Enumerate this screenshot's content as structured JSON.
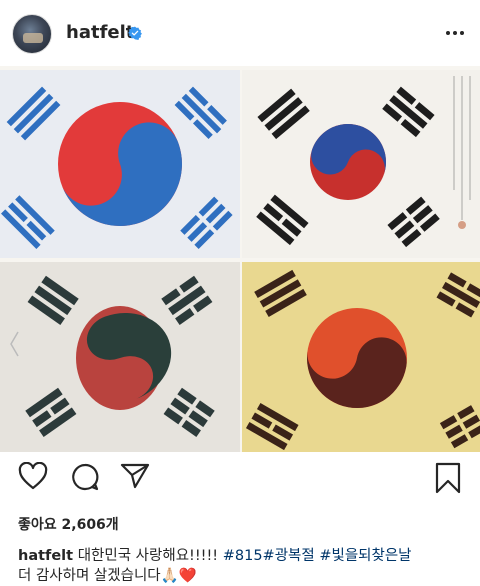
{
  "post": {
    "username": "hatfelt",
    "verified": true,
    "likes_text": "좋아요 2,606개",
    "caption": {
      "username": "hatfelt",
      "text_before": " 대한민국 사랑해요!!!!! ",
      "hashtags": [
        "#815",
        "#광복절",
        "#빛을되찾은날"
      ],
      "text_after": "더 감사하며 살겠습니다",
      "emojis": [
        "🙏🏻",
        "❤️"
      ]
    }
  },
  "icons": {
    "more": "more-options-icon",
    "like": "heart-icon",
    "comment": "comment-icon",
    "share": "send-icon",
    "save": "bookmark-icon",
    "verified": "verified-badge-icon"
  },
  "colors": {
    "text": "#262626",
    "hashtag": "#003569",
    "verified": "#3897f0",
    "heart": "#e0245e"
  }
}
